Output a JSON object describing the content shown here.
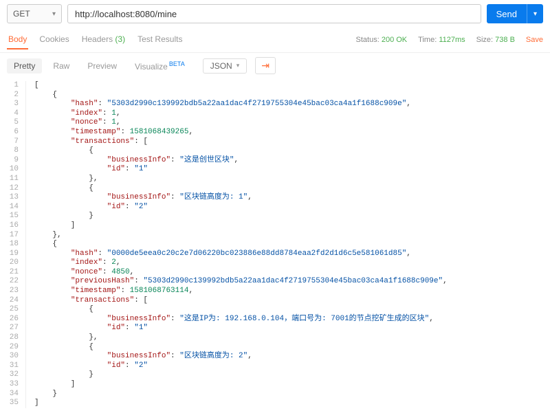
{
  "request": {
    "method": "GET",
    "url": "http://localhost:8080/mine",
    "send_label": "Send"
  },
  "status": {
    "status_label": "Status:",
    "status_value": "200 OK",
    "time_label": "Time:",
    "time_value": "1127ms",
    "size_label": "Size:",
    "size_value": "738 B",
    "save_label": "Save"
  },
  "tabs": {
    "body": "Body",
    "cookies": "Cookies",
    "headers": "Headers",
    "headers_count": "(3)",
    "test_results": "Test Results"
  },
  "viewer": {
    "pretty": "Pretty",
    "raw": "Raw",
    "preview": "Preview",
    "visualize": "Visualize",
    "beta": "BETA",
    "json": "JSON"
  },
  "json_response": [
    {
      "hash": "5303d2990c139992bdb5a22aa1dac4f2719755304e45bac03ca4a1f1688c909e",
      "index": 1,
      "nonce": 1,
      "timestamp": 1581068439265,
      "transactions": [
        {
          "businessInfo": "这是创世区块",
          "id": "1"
        },
        {
          "businessInfo": "区块链高度为: 1",
          "id": "2"
        }
      ]
    },
    {
      "hash": "0000de5eea0c20c2e7d06220bc023886e88dd8784eaa2fd2d1d6c5e581061d85",
      "index": 2,
      "nonce": 4850,
      "previousHash": "5303d2990c139992bdb5a22aa1dac4f2719755304e45bac03ca4a1f1688c909e",
      "timestamp": 1581068763114,
      "transactions": [
        {
          "businessInfo": "这是IP为: 192.168.0.104，端口号为: 7001的节点挖矿生成的区块",
          "id": "1"
        },
        {
          "businessInfo": "区块链高度为: 2",
          "id": "2"
        }
      ]
    }
  ]
}
